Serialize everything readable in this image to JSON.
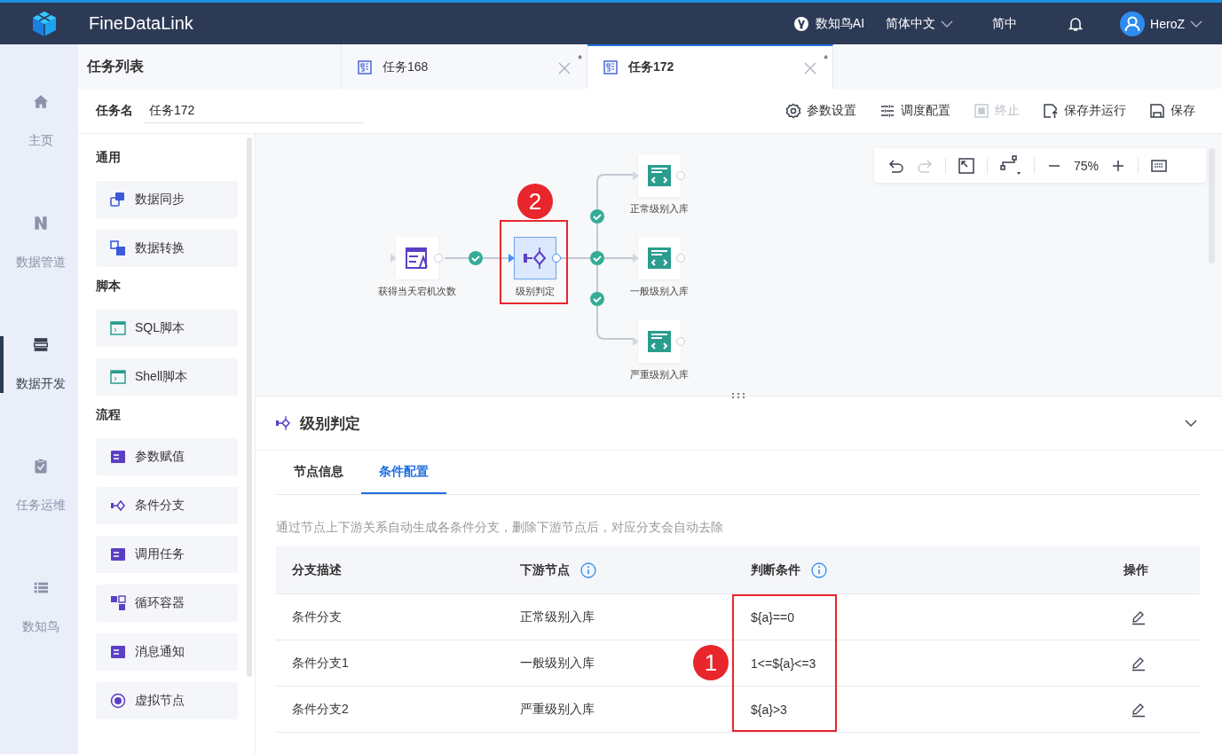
{
  "header": {
    "app_name": "FineDataLink",
    "ai_label": "数知鸟AI",
    "language": "简体中文",
    "short_language": "简中",
    "user": "HeroZ"
  },
  "nav": [
    {
      "label": "主页",
      "selected": false
    },
    {
      "label": "数据管道",
      "selected": false
    },
    {
      "label": "数据开发",
      "selected": true
    },
    {
      "label": "任务运维",
      "selected": false
    },
    {
      "label": "数知鸟",
      "selected": false
    }
  ],
  "task_list_title": "任务列表",
  "tabs": [
    {
      "label": "任务168",
      "mark": "*",
      "selected": false
    },
    {
      "label": "任务172",
      "mark": "*",
      "selected": true
    }
  ],
  "task_name": {
    "label": "任务名",
    "value": "任务172"
  },
  "toolbar": [
    {
      "label": "参数设置",
      "disabled": false
    },
    {
      "label": "调度配置",
      "disabled": false
    },
    {
      "label": "终止",
      "disabled": true
    },
    {
      "label": "保存并运行",
      "disabled": false
    },
    {
      "label": "保存",
      "disabled": false
    }
  ],
  "palette": [
    {
      "title": "通用",
      "items": [
        "数据同步",
        "数据转换"
      ]
    },
    {
      "title": "脚本",
      "items": [
        "SQL脚本",
        "Shell脚本"
      ]
    },
    {
      "title": "流程",
      "items": [
        "参数赋值",
        "条件分支",
        "调用任务",
        "循环容器",
        "消息通知",
        "虚拟节点"
      ]
    }
  ],
  "canvas_toolbar": {
    "undo_disabled": false,
    "redo_disabled": true,
    "zoom": "75%"
  },
  "nodes": [
    {
      "label": "获得当天宕机次数",
      "kind": "assign",
      "selected": false
    },
    {
      "label": "级别判定",
      "kind": "branch",
      "selected": true,
      "callout": "2"
    },
    {
      "label": "正常级别入库",
      "kind": "sql",
      "selected": false
    },
    {
      "label": "一般级别入库",
      "kind": "sql",
      "selected": false
    },
    {
      "label": "严重级别入库",
      "kind": "sql",
      "selected": false
    }
  ],
  "detail": {
    "title": "级别判定",
    "tabs": [
      {
        "label": "节点信息",
        "selected": false
      },
      {
        "label": "条件配置",
        "selected": true
      }
    ],
    "hint": "通过节点上下游关系自动生成各条件分支，删除下游节点后，对应分支会自动去除",
    "columns": [
      {
        "label": "分支描述",
        "info": false
      },
      {
        "label": "下游节点",
        "info": true
      },
      {
        "label": "判断条件",
        "info": true
      },
      {
        "label": "操作",
        "info": false
      }
    ],
    "rows": [
      {
        "description": "条件分支",
        "downstream": "正常级别入库",
        "condition": "${a}==0"
      },
      {
        "description": "条件分支1",
        "downstream": "一般级别入库",
        "condition": "1<=${a}<=3"
      },
      {
        "description": "条件分支2",
        "downstream": "严重级别入库",
        "condition": "${a}>3"
      }
    ],
    "callout": "1"
  }
}
